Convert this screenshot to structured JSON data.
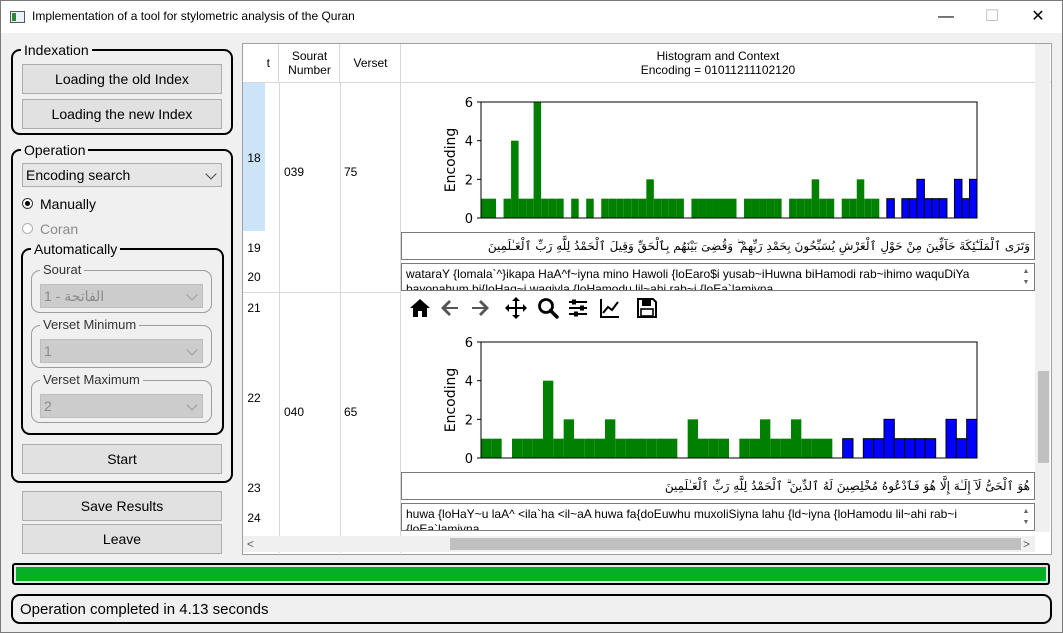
{
  "window": {
    "title": "Implementation of a tool for stylometric analysis of the Quran",
    "min_glyph": "—",
    "max_glyph": "☐",
    "close_glyph": "✕"
  },
  "indexation": {
    "legend": "Indexation",
    "load_old": "Loading the old Index",
    "load_new": "Loading the new Index"
  },
  "operation": {
    "legend": "Operation",
    "search_type": "Encoding search",
    "manually": "Manually",
    "coran": "Coran",
    "automatically": {
      "legend": "Automatically",
      "sourat": {
        "legend": "Sourat",
        "value": "1 - الفاتحة"
      },
      "verset_min": {
        "legend": "Verset Minimum",
        "value": "1"
      },
      "verset_max": {
        "legend": "Verset Maximum",
        "value": "2"
      }
    },
    "start": "Start"
  },
  "actions": {
    "save": "Save Results",
    "leave": "Leave"
  },
  "table": {
    "headers": {
      "col0": "t",
      "sourat": "Sourat Number",
      "verset": "Verset",
      "context": "Histogram and Context"
    },
    "row_numbers": [
      "18",
      "19",
      "20",
      "21",
      "22",
      "23",
      "24"
    ],
    "results": [
      {
        "sourat": "039",
        "verset": "75",
        "encoding_title": "Encoding = 01011211102120",
        "arabic": "وَتَرَى ٱلْمَلَـٰٓئِكَةَ حَآفِّينَ مِنْ حَوْلِ ٱلْعَرْشِ يُسَبِّحُونَ بِحَمْدِ رَبِّهِمْ ۖ وَقُضِىَ بَيْنَهُم بِٱلْحَقِّ وَقِيلَ ٱلْحَمْدُ لِلَّهِ رَبِّ ٱلْعَـٰلَمِينَ",
        "translit": "wataraY {lomala`^}ikapa HaA^f~iyna mino Hawoli {loEaro$i yusab~iHuwna biHamodi rab~ihimo waquDiYa bayonahum bi{loHaq~i waqiyla {loHamodu lil~ahi rab~i {loEa`lamiyna"
      },
      {
        "sourat": "040",
        "verset": "65",
        "encoding_title": "",
        "arabic": "هُوَ ٱلْحَىُّ لَآ إِلَـٰهَ إِلَّا هُوَ فَٱدْعُوهُ مُخْلِصِينَ لَهُ ٱلدِّينَ ۗ ٱلْحَمْدُ لِلَّهِ رَبِّ ٱلْعَـٰلَمِينَ",
        "translit": "huwa {loHaY~u laA^ <ila`ha <il~aA huwa fa{doEuwhu muxoliSiyna lahu {ld~iyna {loHamodu lil~ahi rab~i {loEa`lamiyna"
      }
    ]
  },
  "chart_data": [
    {
      "type": "bar",
      "title": "",
      "xlabel": "",
      "ylabel": "Encoding",
      "ylim": [
        0,
        6
      ],
      "yticks": [
        0,
        2,
        4,
        6
      ],
      "colors": {
        "green": "#008000",
        "blue": "#0000ff"
      },
      "values": [
        1,
        1,
        0,
        1,
        4,
        1,
        1,
        6,
        1,
        1,
        1,
        0,
        1,
        0,
        1,
        0,
        1,
        1,
        1,
        1,
        1,
        1,
        2,
        1,
        1,
        1,
        1,
        0,
        1,
        1,
        1,
        1,
        1,
        1,
        0,
        1,
        1,
        1,
        1,
        1,
        0,
        1,
        1,
        1,
        2,
        1,
        1,
        0,
        1,
        1,
        2,
        1,
        1,
        0,
        1,
        0,
        1,
        1,
        2,
        1,
        1,
        1,
        0,
        2,
        1,
        2
      ],
      "color_index": [
        "green",
        "green",
        "green",
        "green",
        "green",
        "green",
        "green",
        "green",
        "green",
        "green",
        "green",
        "green",
        "green",
        "green",
        "green",
        "green",
        "green",
        "green",
        "green",
        "green",
        "green",
        "green",
        "green",
        "green",
        "green",
        "green",
        "green",
        "green",
        "green",
        "green",
        "green",
        "green",
        "green",
        "green",
        "green",
        "green",
        "green",
        "green",
        "green",
        "green",
        "green",
        "green",
        "green",
        "green",
        "green",
        "green",
        "green",
        "green",
        "green",
        "green",
        "green",
        "green",
        "green",
        "green",
        "blue",
        "blue",
        "blue",
        "blue",
        "blue",
        "blue",
        "blue",
        "blue",
        "blue",
        "blue",
        "blue",
        "blue"
      ]
    },
    {
      "type": "bar",
      "title": "",
      "xlabel": "",
      "ylabel": "Encoding",
      "ylim": [
        0,
        6
      ],
      "yticks": [
        0,
        2,
        4,
        6
      ],
      "colors": {
        "green": "#008000",
        "blue": "#0000ff"
      },
      "values": [
        1,
        1,
        0,
        1,
        1,
        1,
        4,
        1,
        2,
        1,
        1,
        1,
        2,
        1,
        1,
        1,
        1,
        1,
        1,
        0,
        2,
        1,
        1,
        1,
        0,
        1,
        1,
        2,
        1,
        1,
        2,
        1,
        1,
        1,
        0,
        1,
        0,
        1,
        1,
        2,
        1,
        1,
        1,
        1,
        0,
        2,
        1,
        2
      ],
      "color_index": [
        "green",
        "green",
        "green",
        "green",
        "green",
        "green",
        "green",
        "green",
        "green",
        "green",
        "green",
        "green",
        "green",
        "green",
        "green",
        "green",
        "green",
        "green",
        "green",
        "green",
        "green",
        "green",
        "green",
        "green",
        "green",
        "green",
        "green",
        "green",
        "green",
        "green",
        "green",
        "green",
        "green",
        "green",
        "green",
        "blue",
        "blue",
        "blue",
        "blue",
        "blue",
        "blue",
        "blue",
        "blue",
        "blue",
        "blue",
        "blue",
        "blue",
        "blue"
      ]
    }
  ],
  "status": {
    "message": "Operation completed in 4.13 seconds",
    "progress": 1.0
  }
}
